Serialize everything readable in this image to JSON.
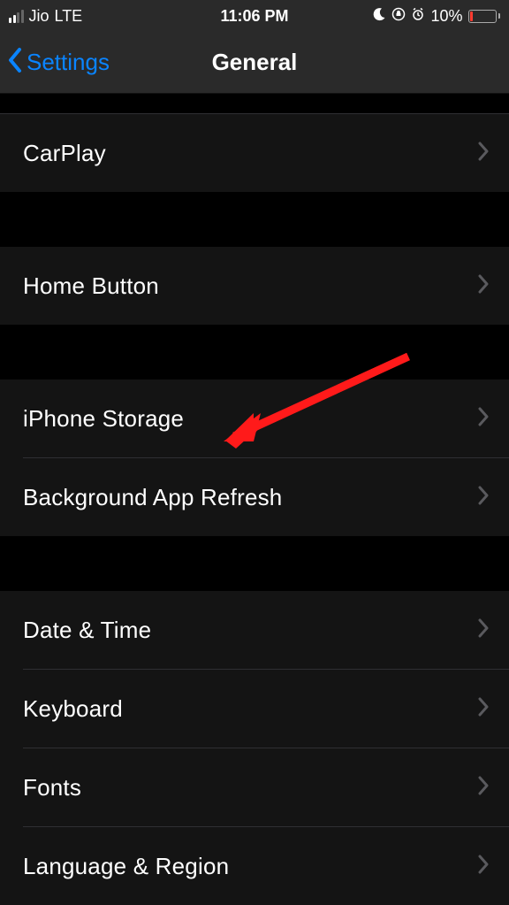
{
  "status": {
    "carrier": "Jio",
    "network": "LTE",
    "time": "11:06 PM",
    "battery_pct": "10%"
  },
  "nav": {
    "back_label": "Settings",
    "title": "General"
  },
  "rows": {
    "carplay": "CarPlay",
    "home_button": "Home Button",
    "iphone_storage": "iPhone Storage",
    "bg_app_refresh": "Background App Refresh",
    "date_time": "Date & Time",
    "keyboard": "Keyboard",
    "fonts": "Fonts",
    "lang_region": "Language & Region"
  }
}
